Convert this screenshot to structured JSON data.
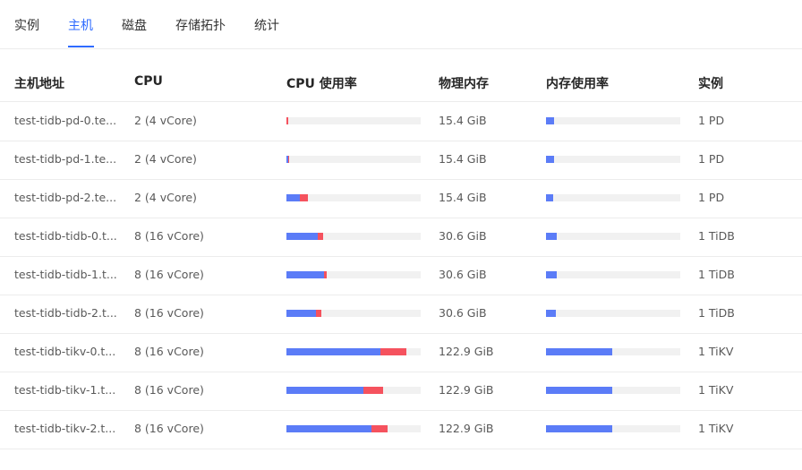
{
  "tabs": [
    {
      "label": "实例",
      "active": false
    },
    {
      "label": "主机",
      "active": true
    },
    {
      "label": "磁盘",
      "active": false
    },
    {
      "label": "存储拓扑",
      "active": false
    },
    {
      "label": "统计",
      "active": false
    }
  ],
  "table": {
    "headers": [
      "主机地址",
      "CPU",
      "CPU 使用率",
      "物理内存",
      "内存使用率",
      "实例"
    ],
    "rows": [
      {
        "host": "test-tidb-pd-0.te...",
        "cpu": "2 (4 vCore)",
        "cpu_user": 0.0,
        "cpu_sys": 0.013,
        "memory": "15.4 GiB",
        "mem_usage": 0.06,
        "instance": "1 PD"
      },
      {
        "host": "test-tidb-pd-1.te...",
        "cpu": "2 (4 vCore)",
        "cpu_user": 0.013,
        "cpu_sys": 0.007,
        "memory": "15.4 GiB",
        "mem_usage": 0.06,
        "instance": "1 PD"
      },
      {
        "host": "test-tidb-pd-2.te...",
        "cpu": "2 (4 vCore)",
        "cpu_user": 0.1,
        "cpu_sys": 0.06,
        "memory": "15.4 GiB",
        "mem_usage": 0.05,
        "instance": "1 PD"
      },
      {
        "host": "test-tidb-tidb-0.t...",
        "cpu": "8 (16 vCore)",
        "cpu_user": 0.23,
        "cpu_sys": 0.04,
        "memory": "30.6 GiB",
        "mem_usage": 0.08,
        "instance": "1 TiDB"
      },
      {
        "host": "test-tidb-tidb-1.t...",
        "cpu": "8 (16 vCore)",
        "cpu_user": 0.28,
        "cpu_sys": 0.02,
        "memory": "30.6 GiB",
        "mem_usage": 0.08,
        "instance": "1 TiDB"
      },
      {
        "host": "test-tidb-tidb-2.t...",
        "cpu": "8 (16 vCore)",
        "cpu_user": 0.22,
        "cpu_sys": 0.04,
        "memory": "30.6 GiB",
        "mem_usage": 0.07,
        "instance": "1 TiDB"
      },
      {
        "host": "test-tidb-tikv-0.t...",
        "cpu": "8 (16 vCore)",
        "cpu_user": 0.7,
        "cpu_sys": 0.19,
        "memory": "122.9 GiB",
        "mem_usage": 0.49,
        "instance": "1 TiKV"
      },
      {
        "host": "test-tidb-tikv-1.t...",
        "cpu": "8 (16 vCore)",
        "cpu_user": 0.57,
        "cpu_sys": 0.15,
        "memory": "122.9 GiB",
        "mem_usage": 0.49,
        "instance": "1 TiKV"
      },
      {
        "host": "test-tidb-tikv-2.t...",
        "cpu": "8 (16 vCore)",
        "cpu_user": 0.63,
        "cpu_sys": 0.12,
        "memory": "122.9 GiB",
        "mem_usage": 0.49,
        "instance": "1 TiKV"
      }
    ]
  },
  "colors": {
    "accent": "#2f6bff",
    "cpu_user": "#5b7cf7",
    "cpu_sys": "#f5525e",
    "memory": "#5b7cf7",
    "track": "#f1f1f1"
  }
}
